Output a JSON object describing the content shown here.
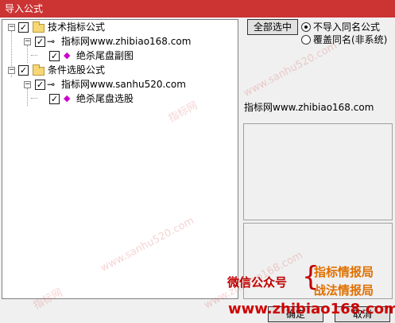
{
  "window": {
    "title": "导入公式"
  },
  "tree": {
    "groups": [
      {
        "label": "技术指标公式",
        "checked": true,
        "children": [
          {
            "label": "指标网www.zhibiao168.com",
            "checked": true,
            "children": [
              {
                "label": "绝杀尾盘副图",
                "checked": true
              }
            ]
          }
        ]
      },
      {
        "label": "条件选股公式",
        "checked": true,
        "children": [
          {
            "label": "指标网www.sanhu520.com",
            "checked": true,
            "children": [
              {
                "label": "绝杀尾盘选股",
                "checked": true
              }
            ]
          }
        ]
      }
    ]
  },
  "controls": {
    "select_all_label": "全部选中",
    "radio_options": [
      {
        "label": "不导入同名公式",
        "selected": true
      },
      {
        "label": "覆盖同名(非系统)",
        "selected": false
      }
    ],
    "info_text": "指标网www.zhibiao168.com"
  },
  "footer": {
    "ok_label": "确定",
    "cancel_label": "取消"
  },
  "overlay": {
    "watermarks": [
      "www.sanhu520.com",
      "指标网",
      "www.sanhu520.com",
      "指标网",
      "www.zhibiao168.com"
    ],
    "ad_wechat": "微信公众号",
    "ad_line1": "指标情报局",
    "ad_line2": "战法情报局",
    "ad_url": "www.zhibiao168.com"
  },
  "icons": {
    "expander": "minus-box-icon",
    "folder": "folder-icon",
    "key": "key-icon",
    "formula": "gem-icon"
  },
  "colors": {
    "titlebar": "#cc3333",
    "ad_red": "#c00000",
    "ad_orange": "#e07000"
  }
}
